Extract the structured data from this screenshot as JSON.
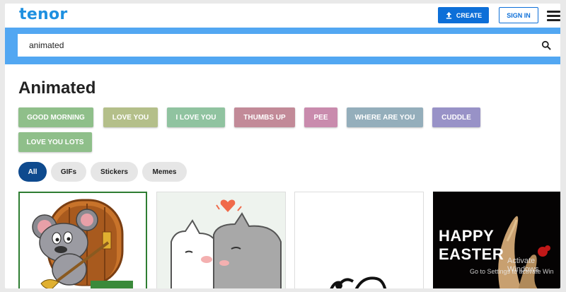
{
  "app": {
    "logo": "tenor"
  },
  "header": {
    "create_label": "CREATE",
    "signin_label": "SIGN IN"
  },
  "search": {
    "value": "animated"
  },
  "page": {
    "title": "Animated"
  },
  "tags": [
    {
      "label": "GOOD MORNING",
      "color": "#8fbf8a"
    },
    {
      "label": "LOVE YOU",
      "color": "#b4bf8a"
    },
    {
      "label": "I LOVE YOU",
      "color": "#90c3a0"
    },
    {
      "label": "THUMBS UP",
      "color": "#c28a98"
    },
    {
      "label": "PEE",
      "color": "#c98bad"
    },
    {
      "label": "WHERE ARE YOU",
      "color": "#94aebb"
    },
    {
      "label": "CUDDLE",
      "color": "#9892c7"
    },
    {
      "label": "LOVE YOU LOTS",
      "color": "#8fbf8a"
    }
  ],
  "filters": [
    "All",
    "GIFs",
    "Stickers",
    "Memes"
  ],
  "results": {
    "easter_text": "HAPPY EASTER",
    "watermark_line1": "Activate Windows",
    "watermark_line2": "Go to Settings to activate Win"
  }
}
